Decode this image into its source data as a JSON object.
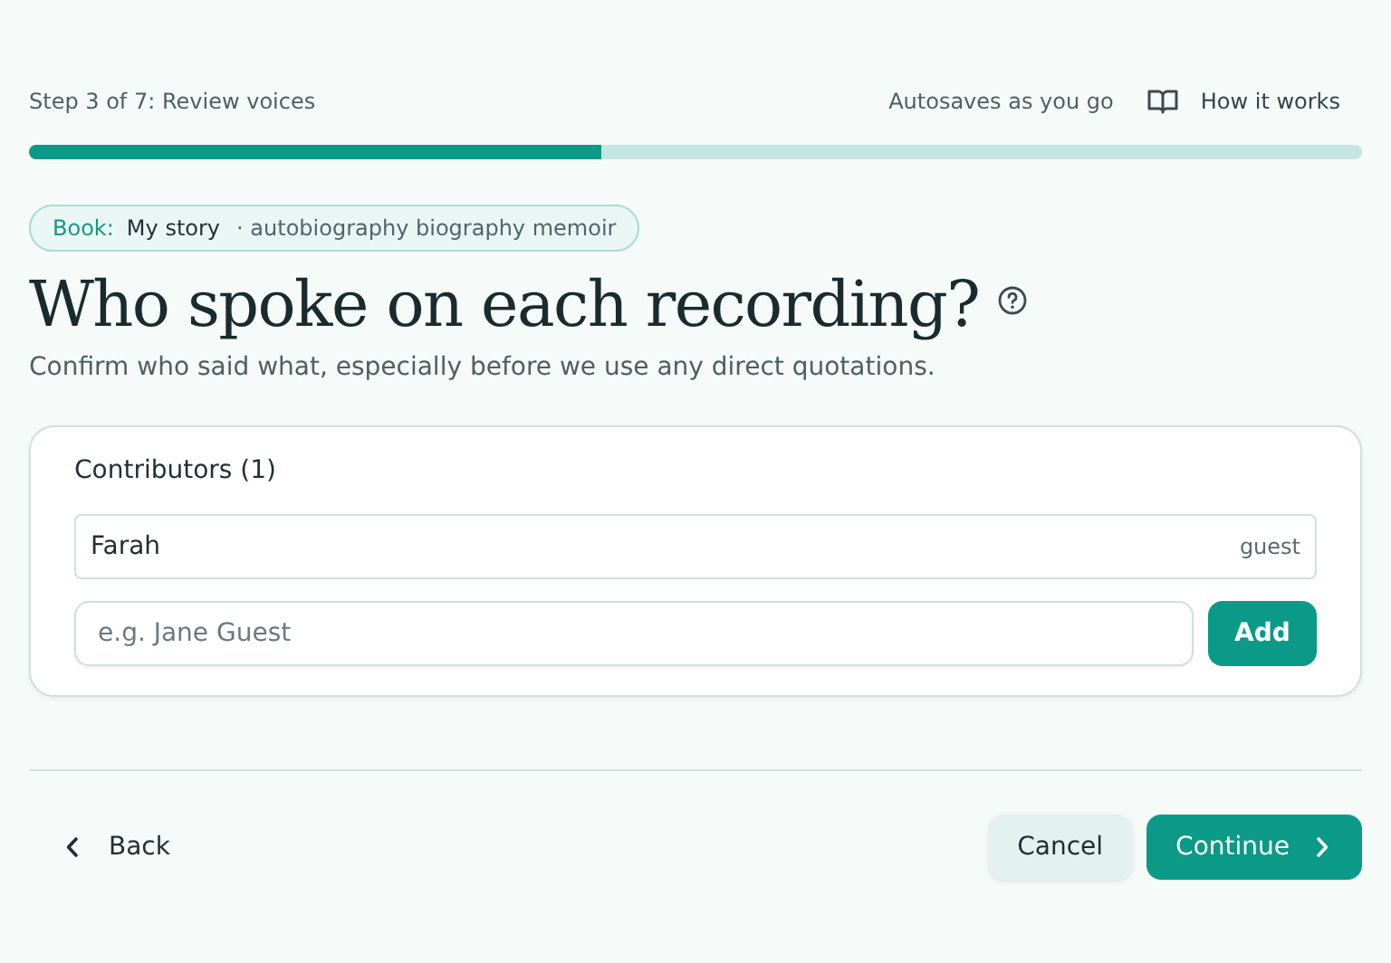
{
  "header": {
    "step": "Step 3 of 7: Review voices",
    "autosave": "Autosaves as you go",
    "help_link": "How it works"
  },
  "progress": {
    "level": 0.43
  },
  "book_chip": {
    "label": "Book:",
    "title": "My story",
    "tags": "· autobiography biography memoir"
  },
  "title": "Who spoke on each recording?",
  "subtitle": "Confirm who said what, especially before we use any direct quotations.",
  "contributors": {
    "heading": "Contributors (1)",
    "items": [
      {
        "name": "Farah",
        "role": "guest"
      }
    ],
    "new_field": {
      "placeholder": "e.g. Jane Guest"
    },
    "add_button": "Add"
  },
  "footer": {
    "back": "Back",
    "cancel": "Cancel",
    "continue": "Continue"
  }
}
